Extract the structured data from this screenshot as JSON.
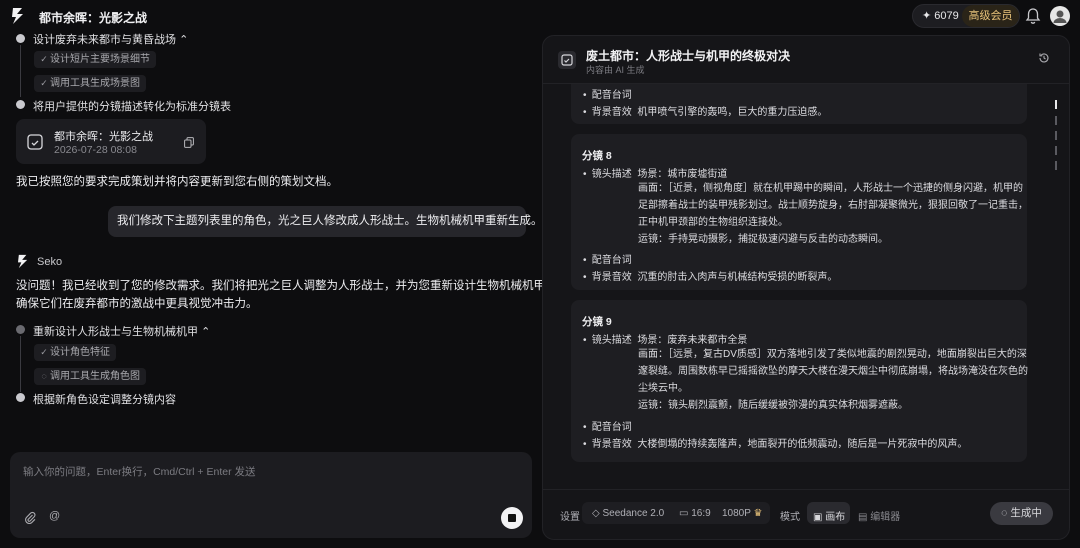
{
  "header": {
    "project_title": "都市余晖：光影之战",
    "credits": "6079",
    "vip_label": "高级会员"
  },
  "chat": {
    "step_top": "设计废弃未来都市与黄昏战场",
    "chip_design_scene": "设计短片主要场景细节",
    "chip_tool_scene": "调用工具生成场景图",
    "step_convert": "将用户提供的分镜描述转化为标准分镜表",
    "card_title": "都市余晖：光影之战",
    "card_time": "2026-07-28 08:08",
    "done_msg": "我已按照您的要求完成策划并将内容更新到您右侧的策划文档。",
    "user_msg": "我们修改下主题列表里的角色，光之巨人修改成人形战士。生物机械机甲重新生成。",
    "bot_name": "Seko",
    "reply_line1": "没问题！我已经收到了您的修改需求。我们将把光之巨人调整为人形战士，并为您重新设计生物机械机甲，",
    "reply_line2": "确保它们在废弃都市的激战中更具视觉冲击力。",
    "step_redesign": "重新设计人形战士与生物机械机甲",
    "chip_design_char": "设计角色特征",
    "chip_tool_char": "调用工具生成角色图",
    "step_adjust": "根据新角色设定调整分镜内容",
    "input_placeholder": "输入你的问题，Enter换行，Cmd/Ctrl + Enter 发送"
  },
  "panel": {
    "title": "废土都市：人形战士与机甲的终极对决",
    "subtitle": "内容由 AI 生成",
    "prev_dub": "配音台词",
    "prev_sfx_label": "背景音效",
    "prev_sfx": "机甲喷气引擎的轰鸣，巨大的重力压迫感。",
    "s8": {
      "head": "分镜 8",
      "desc_label": "镜头描述",
      "scene": "场景：城市废墟街道",
      "pic1": "画面：［近景，侧视角度］就在机甲踢中的瞬间，人形战士一个迅捷的侧身闪避，机甲的",
      "pic2": "足部擦着战士的装甲残影划过。战士顺势旋身，右肘部凝聚微光，狠狠回敬了一记重击，",
      "pic3": "正中机甲颈部的生物组织连接处。",
      "cam": "运镜：手持晃动摄影，捕捉极速闪避与反击的动态瞬间。",
      "dub": "配音台词",
      "sfx_label": "背景音效",
      "sfx": "沉重的肘击入肉声与机械结构受损的断裂声。"
    },
    "s9": {
      "head": "分镜 9",
      "desc_label": "镜头描述",
      "scene": "场景：废弃未来都市全景",
      "pic1": "画面：［远景，复古DV质感］双方落地引发了类似地震的剧烈晃动，地面崩裂出巨大的深",
      "pic2": "邃裂缝。周围数栋早已摇摇欲坠的摩天大楼在漫天烟尘中彻底崩塌，将战场淹没在灰色的",
      "pic3": "尘埃云中。",
      "cam": "运镜：镜头剧烈震颤，随后缓缓被弥漫的真实体积烟雾遮蔽。",
      "dub": "配音台词",
      "sfx_label": "背景音效",
      "sfx": "大楼倒塌的持续轰隆声，地面裂开的低频震动，随后是一片死寂中的风声。"
    },
    "bar": {
      "settings": "设置",
      "model": "Seedance 2.0",
      "ratio": "16:9",
      "res": "1080P",
      "mode": "模式",
      "canvas": "画布",
      "editor": "编辑器",
      "generate": "生成中"
    }
  }
}
